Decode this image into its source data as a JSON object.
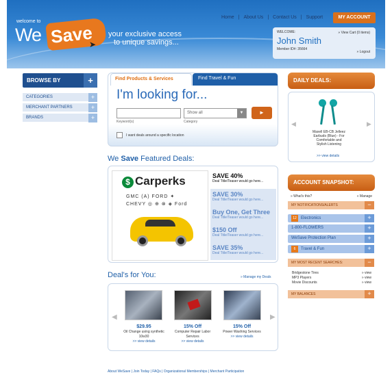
{
  "header": {
    "welcome": "welcome to",
    "logo_we": "We",
    "logo_save": "Save",
    "tagline_1": "your exclusive access",
    "tagline_2": "to unique savings...",
    "nav": [
      "Home",
      "About Us",
      "Contact Us",
      "Support"
    ],
    "my_account": "MY ACCOUNT",
    "user": {
      "welcome": "WELCOME:",
      "cart": "» View Cart (0 items)",
      "name": "John Smith",
      "member": "Member ID#: 35664",
      "logout": "» Logout"
    }
  },
  "sidebar": {
    "title": "BROWSE BY",
    "items": [
      "CATEGORIES",
      "MERCHANT PARTNERS",
      "BRANDS"
    ]
  },
  "search": {
    "tab_products": "Find Products & Services",
    "tab_travel": "Find Travel & Fun",
    "heading": "I'm looking for...",
    "keyword_label": "Keyword(s)",
    "category_value": "Show all",
    "category_label": "Category",
    "go": "►",
    "location_checkbox": "I want deals around a specific location"
  },
  "featured": {
    "title_pre": "We ",
    "title_bold": "Save",
    "title_post": " Featured Deals:",
    "carperks": "Carperks",
    "brands_text": "GMC (A) FORD ✦ CHEVY ◎ ⊕ ⊗ ◈ Ford",
    "deals": [
      {
        "title": "SAVE 40%",
        "sub": "Deal Title/Teaser would go here..."
      },
      {
        "title": "SAVE 30%",
        "sub": "Deal Title/Teaser would go here..."
      },
      {
        "title": "Buy One, Get Three",
        "sub": "Deal Title/Teaser would go here..."
      },
      {
        "title": "$150 Off",
        "sub": "Deal Title/Teaser would go here..."
      },
      {
        "title": "SAVE 35%",
        "sub": "Deal Title/Teaser would go here..."
      }
    ]
  },
  "deals_for_you": {
    "title": "Deal's for You:",
    "manage": "» Manage my Deals",
    "items": [
      {
        "price": "$29.95",
        "desc": "Oil Change using synthetic 10w30",
        "view": ">> view details"
      },
      {
        "price": "15% Off",
        "desc": "Computer Repair Labor Services",
        "view": ">> view details"
      },
      {
        "price": "15% Off",
        "desc": "Power Washing Services",
        "view": ">> view details"
      }
    ]
  },
  "daily": {
    "title": "DAILY DEALS:",
    "product": "Maxell EB-CB Jelleez Earbuds (Blue) - For Comfortable and Stylish Listening",
    "view": ">> view details"
  },
  "account": {
    "title": "ACCOUNT SNAPSHOT:",
    "whats_this": "» What's this?",
    "manage": "» Manage",
    "notifications": "MY NOTIFICATIONS/ALERTS",
    "alerts": [
      {
        "num": "12",
        "label": "Electronics"
      },
      {
        "num": "",
        "label": "1-800-FLOWERS"
      },
      {
        "num": "",
        "label": "WeSave Protection Plan"
      },
      {
        "num": "6",
        "label": "Travel & Fun"
      }
    ],
    "recent_searches_title": "MY MOST RECENT SEARCHES:",
    "recent_searches": [
      "Bridgestone Tires",
      "MP3 Players",
      "Movie Discounts"
    ],
    "view": "» view",
    "balances": "MY BALANCES"
  },
  "footer": {
    "links": "About WeSave  |  Join Today  |  FAQs  |  Organizational Memberships  |  Merchant Participation"
  },
  "colors": {
    "brand_blue": "#1f6fc0",
    "brand_orange": "#e8781e"
  }
}
